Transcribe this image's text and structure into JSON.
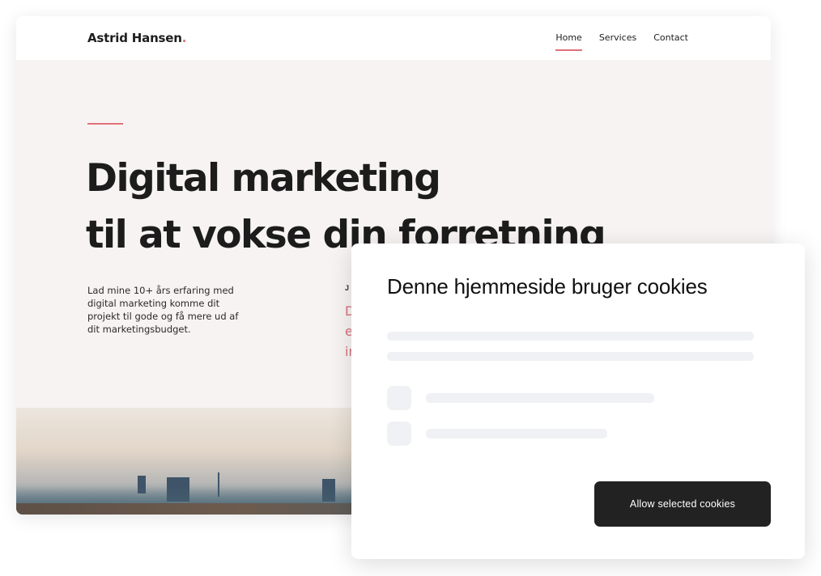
{
  "site": {
    "brand": "Astrid Hansen",
    "brand_dot": ".",
    "nav": [
      {
        "label": "Home",
        "active": true
      },
      {
        "label": "Services",
        "active": false
      },
      {
        "label": "Contact",
        "active": false
      }
    ],
    "hero": {
      "title_line1": "Digital marketing",
      "title_line2": "til at vokse din forretning",
      "description": "Lad mine 10+ års erfaring med digital marketing komme dit projekt til gode og få mere ud af dit marketingsbudget.",
      "partial_heading": "J",
      "partial_lines": [
        "D",
        "e",
        "in"
      ]
    }
  },
  "cookie_dialog": {
    "title": "Denne hjemmeside bruger cookies",
    "allow_button": "Allow selected cookies"
  },
  "colors": {
    "accent": "#e07078",
    "button": "#222222",
    "hero_bg": "#f7f3f2"
  }
}
